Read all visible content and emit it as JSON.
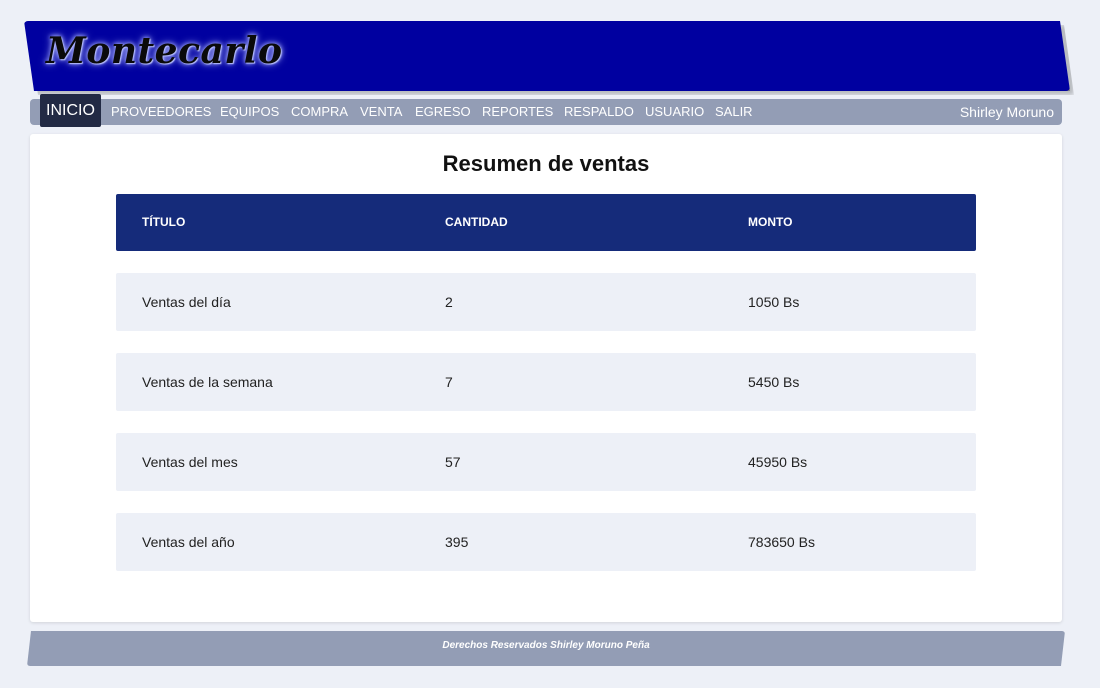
{
  "header": {
    "logo_text": "Montecarlo",
    "banner_color": "#0000a0"
  },
  "nav": {
    "items": [
      {
        "label": "INICIO",
        "active": true
      },
      {
        "label": "PROVEEDORES"
      },
      {
        "label": "EQUIPOS"
      },
      {
        "label": "COMPRA"
      },
      {
        "label": "VENTA"
      },
      {
        "label": "EGRESO"
      },
      {
        "label": "REPORTES"
      },
      {
        "label": "RESPALDO"
      },
      {
        "label": "USUARIO"
      },
      {
        "label": "SALIR"
      }
    ],
    "user": "Shirley Moruno",
    "bar_color": "#939db5"
  },
  "main": {
    "title": "Resumen de ventas",
    "table": {
      "headers": [
        "TÍTULO",
        "CANTIDAD",
        "MONTO"
      ],
      "header_color": "#152b7a",
      "rows": [
        {
          "titulo": "Ventas del día",
          "cantidad": "2",
          "monto": "1050 Bs"
        },
        {
          "titulo": "Ventas de la semana",
          "cantidad": "7",
          "monto": "5450 Bs"
        },
        {
          "titulo": "Ventas del mes",
          "cantidad": "57",
          "monto": "45950 Bs"
        },
        {
          "titulo": "Ventas del año",
          "cantidad": "395",
          "monto": "783650 Bs"
        }
      ]
    }
  },
  "footer": {
    "text": "Derechos Reservados Shirley Moruno Peña"
  }
}
